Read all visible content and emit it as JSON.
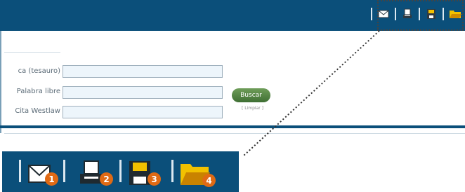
{
  "form": {
    "fields": [
      {
        "label": "ca (tesauro)",
        "value": ""
      },
      {
        "label": "Palabra libre",
        "value": ""
      },
      {
        "label": "Cita Westlaw",
        "value": ""
      }
    ],
    "search_button_label": "Buscar",
    "clear_link_label": "[ Limpiar ]"
  },
  "toolbar": {
    "icons": [
      "email-icon",
      "print-icon",
      "save-icon",
      "folder-icon"
    ]
  },
  "callout": {
    "badges": [
      "1",
      "2",
      "3",
      "4"
    ]
  },
  "colors": {
    "header_blue": "#0b4f7a",
    "badge_orange": "#e06a14",
    "button_green": "#4f7f3f",
    "input_bg": "#edf5fb"
  }
}
